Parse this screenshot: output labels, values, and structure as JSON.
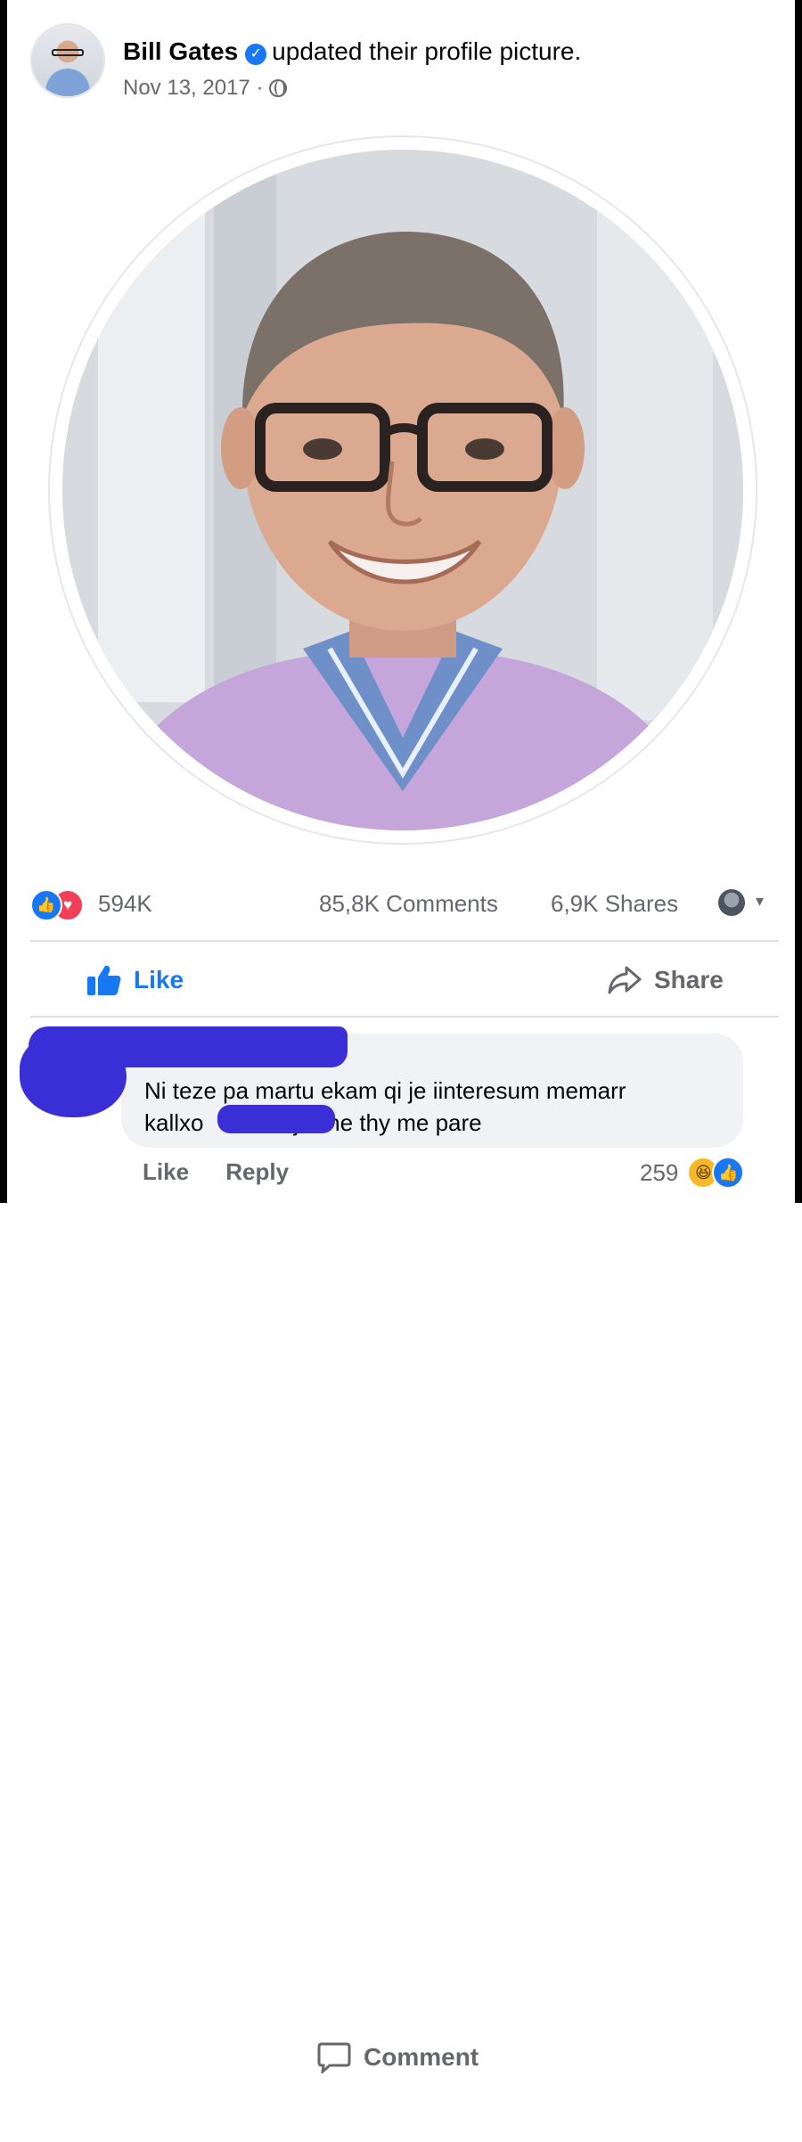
{
  "post": {
    "author": "Bill Gates",
    "action": "updated their profile picture.",
    "date": "Nov 13, 2017",
    "separator": "·"
  },
  "icons": {
    "verified": "verified-badge-icon",
    "privacy": "globe-icon",
    "like": "thumbs-up-icon",
    "comment": "speech-bubble-icon",
    "share": "share-arrow-icon"
  },
  "stats": {
    "reactions": "594K",
    "comments": "85,8K Comments",
    "shares": "6,9K Shares"
  },
  "actions": {
    "like": "Like",
    "comment": "Comment",
    "share": "Share"
  },
  "comment": {
    "line1": "Ni teze pa martu ekam qi je iinteresum memarr",
    "line2": "kallxo          najkishe thy me pare",
    "like": "Like",
    "reply": "Reply",
    "reaction_count": "259"
  },
  "colors": {
    "brand_blue": "#1877f2",
    "secondary_text": "#65676b",
    "love_red": "#f33e58",
    "redaction": "#3a2fd6"
  }
}
